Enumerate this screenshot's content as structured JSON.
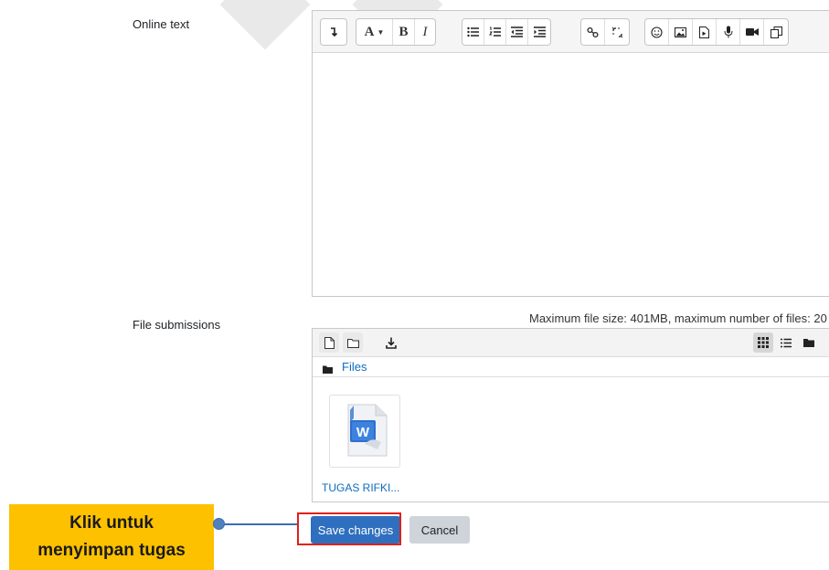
{
  "form": {
    "online_text_label": "Online text",
    "file_submissions_label": "File submissions"
  },
  "editor": {
    "toolbar_groups": [
      [
        "collapse-icon"
      ],
      [
        "font-size-icon",
        "bold-icon",
        "italic-icon"
      ],
      [
        "unordered-list-icon",
        "ordered-list-icon",
        "outdent-icon",
        "indent-icon"
      ],
      [
        "link-icon",
        "unlink-icon"
      ],
      [
        "emoji-icon",
        "image-icon",
        "media-icon",
        "record-audio-icon",
        "record-video-icon",
        "manage-files-icon"
      ]
    ]
  },
  "filepicker": {
    "max_info": "Maximum file size: 401MB, maximum number of files: 20",
    "path": "Files",
    "files": [
      {
        "name": "TUGAS RIFKI...",
        "icon": "word-document-icon"
      }
    ]
  },
  "buttons": {
    "save": "Save changes",
    "cancel": "Cancel"
  },
  "callout": {
    "line1": "Klik untuk",
    "line2": "menyimpan tugas"
  }
}
